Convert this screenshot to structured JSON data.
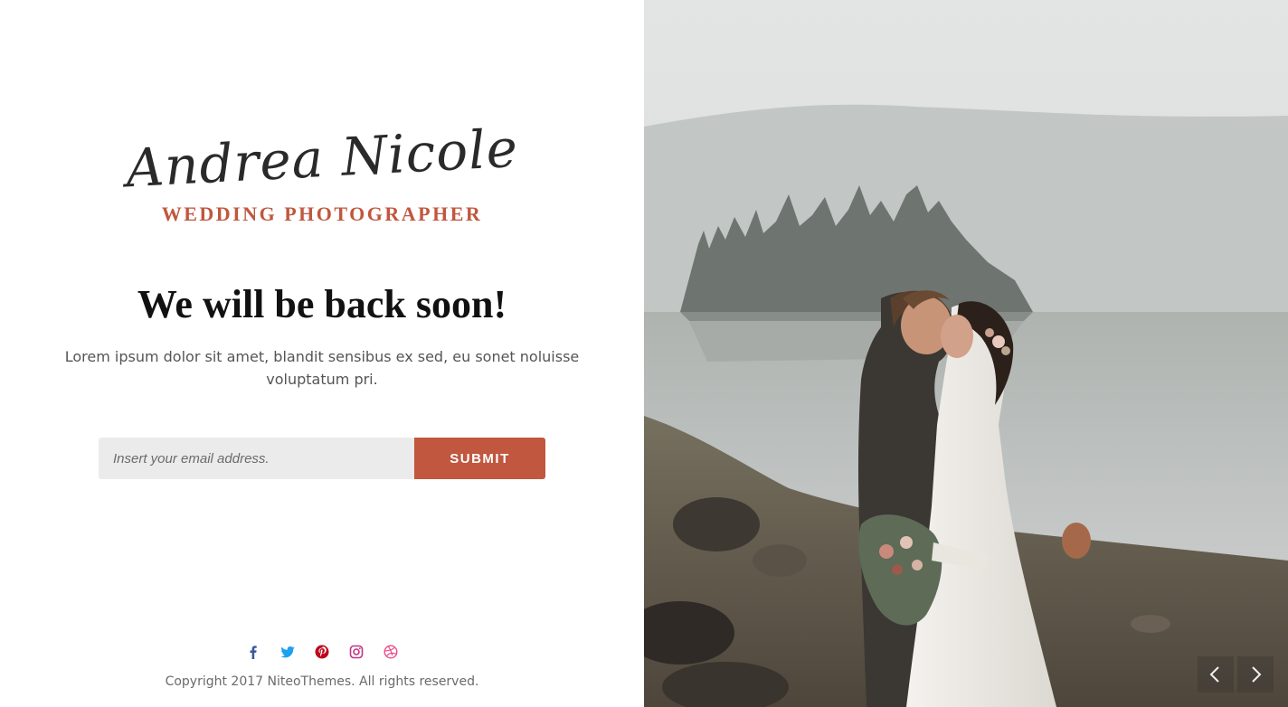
{
  "brand": {
    "name": "Andrea Nicole",
    "tagline": "WEDDING PHOTOGRAPHER",
    "accent_color": "#c0573e"
  },
  "main": {
    "headline": "We will be back soon!",
    "description": "Lorem ipsum dolor sit amet, blandit sensibus ex sed, eu sonet noluisse voluptatum pri."
  },
  "subscribe": {
    "email_placeholder": "Insert your email address.",
    "submit_label": "SUBMIT"
  },
  "social": [
    {
      "icon": "facebook-icon",
      "color": "#3b5998"
    },
    {
      "icon": "twitter-icon",
      "color": "#1da1f2"
    },
    {
      "icon": "pinterest-icon",
      "color": "#bd081c"
    },
    {
      "icon": "instagram-icon",
      "color": "#c13584"
    },
    {
      "icon": "dribbble-icon",
      "color": "#ea4c89"
    }
  ],
  "footer": {
    "copyright": "Copyright 2017 NiteoThemes. All rights reserved."
  },
  "slider": {
    "prev_icon": "chevron-left-icon",
    "next_icon": "chevron-right-icon"
  }
}
